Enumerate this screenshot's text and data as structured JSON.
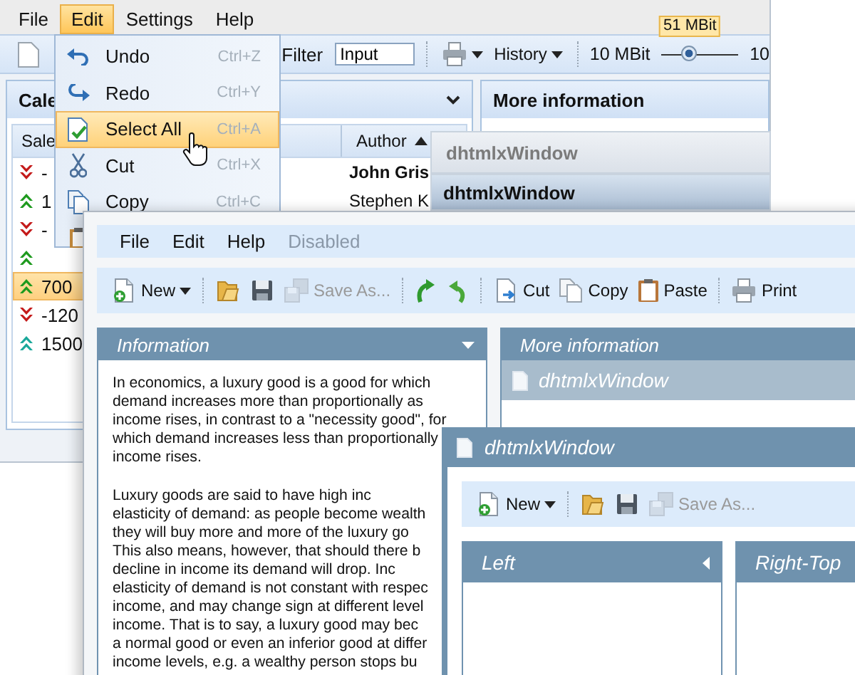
{
  "back_window": {
    "menu": [
      {
        "label": "File",
        "selected": false
      },
      {
        "label": "Edit",
        "selected": true
      },
      {
        "label": "Settings",
        "selected": false
      },
      {
        "label": "Help",
        "selected": false
      }
    ],
    "toolbar": {
      "filter_label": "Filter",
      "filter_value": "Input",
      "history": "History",
      "speed_min": "10 MBit",
      "speed_tooltip": "51 MBit",
      "speed_max": "10",
      "level": 0.37
    },
    "left_panel": {
      "title": "Cale",
      "columns": [
        {
          "label": "Sale"
        },
        {
          "label": "Author",
          "sorted": true
        }
      ],
      "rows": [
        {
          "kind": "down",
          "color": "#c41a1a",
          "value": "-",
          "author": "John Gris",
          "selected": false
        },
        {
          "kind": "up",
          "color": "#1e9a1e",
          "value": "1",
          "author": "Stephen K",
          "selected": false
        },
        {
          "kind": "down",
          "color": "#c41a1a",
          "value": "-",
          "selected": false
        },
        {
          "kind": "up",
          "color": "#1e9a1e",
          "selected": false
        },
        {
          "kind": "up",
          "color": "#1e9a1e",
          "value": "700",
          "selected": true
        },
        {
          "kind": "down",
          "color": "#c41a1a",
          "value": "-120",
          "selected": false
        },
        {
          "kind": "up",
          "color": "#1aa89a",
          "value": "1500",
          "selected": false
        }
      ]
    },
    "right_panel": {
      "title": "More information"
    }
  },
  "edit_menu": {
    "items": [
      {
        "kind": "undo",
        "label": "Undo",
        "shortcut": "Ctrl+Z",
        "selected": false
      },
      {
        "kind": "redo",
        "label": "Redo",
        "shortcut": "Ctrl+Y",
        "selected": false
      },
      {
        "kind": "select-all",
        "label": "Select All",
        "shortcut": "Ctrl+A",
        "selected": true
      },
      {
        "kind": "cut",
        "label": "Cut",
        "shortcut": "Ctrl+X",
        "selected": false
      },
      {
        "kind": "copy",
        "label": "Copy",
        "shortcut": "Ctrl+C",
        "selected": false
      },
      {
        "kind": "paste",
        "selected": false
      }
    ]
  },
  "header_windows": [
    {
      "title": "dhtmlxWindow",
      "active": false
    },
    {
      "title": "dhtmlxWindow",
      "active": true
    }
  ],
  "main_window": {
    "menu": [
      {
        "label": "File",
        "disabled": false
      },
      {
        "label": "Edit",
        "disabled": false
      },
      {
        "label": "Help",
        "disabled": false
      },
      {
        "label": "Disabled",
        "disabled": true
      }
    ],
    "toolbar": [
      {
        "kind": "new",
        "label": "New",
        "dropdown": true,
        "disabled": false
      },
      {
        "kind": "separator"
      },
      {
        "kind": "open",
        "disabled": false
      },
      {
        "kind": "save",
        "disabled": false
      },
      {
        "kind": "save-as",
        "label": "Save As...",
        "disabled": true
      },
      {
        "kind": "separator"
      },
      {
        "kind": "redo",
        "disabled": false
      },
      {
        "kind": "undo",
        "disabled": false
      },
      {
        "kind": "separator"
      },
      {
        "kind": "cut",
        "label": "Cut",
        "disabled": false
      },
      {
        "kind": "copy",
        "label": "Copy",
        "disabled": false
      },
      {
        "kind": "paste",
        "label": "Paste",
        "disabled": false
      },
      {
        "kind": "separator"
      },
      {
        "kind": "print",
        "label": "Print",
        "disabled": false
      }
    ],
    "info_panel": {
      "title": "Information",
      "collapse_arrow": true,
      "paragraphs": [
        [
          "In economics, a luxury good is a good for which",
          "demand increases more than proportionally as",
          "income rises, in contrast to a \"necessity good\", for",
          "which demand increases less than proportionally",
          "income rises."
        ],
        [
          "Luxury goods are said to have high inc",
          "elasticity of demand: as people become wealth",
          "they will buy more and more of the luxury go",
          "This also means, however, that should there b",
          "decline in income its demand will drop. Inc",
          "elasticity of demand is not constant with respec",
          "income, and may change sign at different level",
          "income. That is to say, a luxury good may bec",
          "a normal good or even an inferior good at differ",
          "income levels, e.g. a wealthy person stops bu"
        ]
      ]
    },
    "more_panel": {
      "title": "More information",
      "inner_window": {
        "title": "dhtmlxWindow"
      }
    }
  },
  "front_window": {
    "title": "dhtmlxWindow",
    "toolbar": [
      {
        "kind": "new",
        "label": "New",
        "dropdown": true,
        "disabled": false
      },
      {
        "kind": "separator"
      },
      {
        "kind": "open",
        "disabled": false
      },
      {
        "kind": "save",
        "disabled": false
      },
      {
        "kind": "save-as",
        "label": "Save As...",
        "disabled": true
      }
    ],
    "panels": [
      {
        "title": "Left",
        "collapse_arrow": true
      },
      {
        "title": "Right-Top",
        "collapse_arrow": false
      }
    ]
  }
}
